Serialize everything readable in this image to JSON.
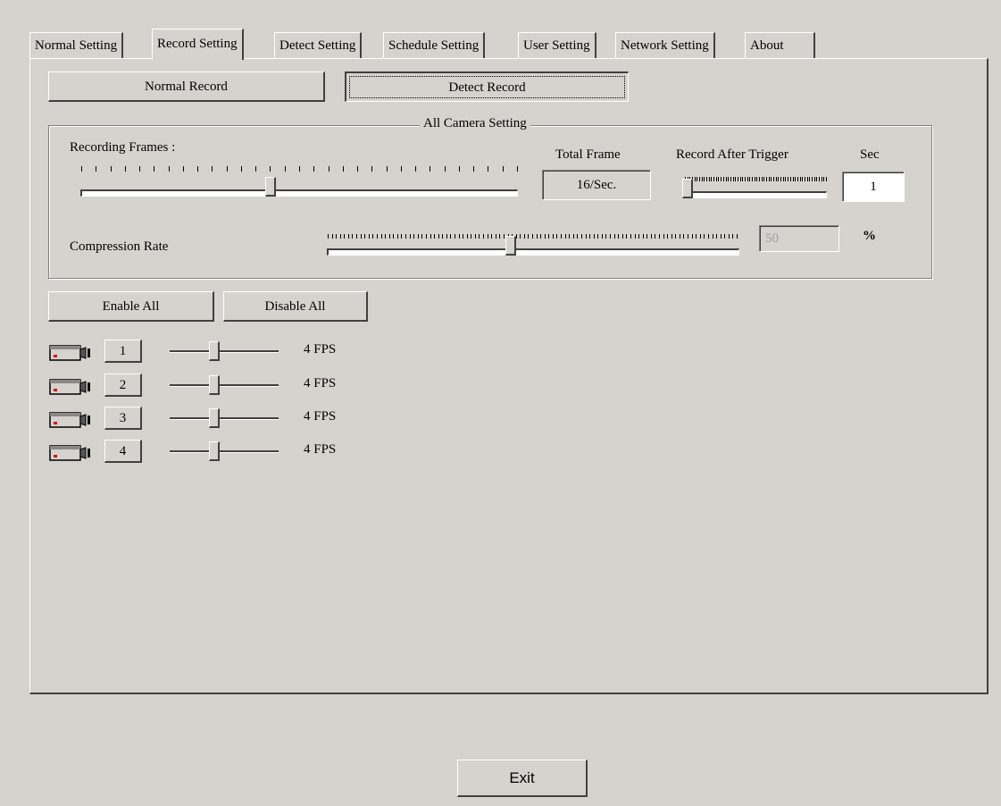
{
  "tabs": [
    {
      "label": "Normal Setting",
      "active": false
    },
    {
      "label": "Record Setting",
      "active": true
    },
    {
      "label": "Detect Setting",
      "active": false
    },
    {
      "label": "Schedule Setting",
      "active": false
    },
    {
      "label": "User Setting",
      "active": false
    },
    {
      "label": "Network Setting",
      "active": false
    },
    {
      "label": "About",
      "active": false
    }
  ],
  "mode_buttons": {
    "normal_record": "Normal Record",
    "detect_record": "Detect Record",
    "selected": "detect_record"
  },
  "all_camera": {
    "title": "All Camera Setting",
    "recording_frames_label": "Recording Frames :",
    "total_frame_label": "Total Frame",
    "total_frame_value": "16/Sec.",
    "record_after_trigger_label": "Record After Trigger",
    "sec_label": "Sec",
    "sec_value": "1",
    "compression_label": "Compression Rate",
    "compression_value": "50",
    "percent_symbol": "%"
  },
  "bulk_buttons": {
    "enable_all": "Enable All",
    "disable_all": "Disable All"
  },
  "cameras": [
    {
      "id": "1",
      "fps": "4 FPS"
    },
    {
      "id": "2",
      "fps": "4 FPS"
    },
    {
      "id": "3",
      "fps": "4 FPS"
    },
    {
      "id": "4",
      "fps": "4 FPS"
    }
  ],
  "exit_label": "Exit",
  "colors": {
    "face": "#d6d3ce",
    "shadow": "#404040",
    "highlight": "#ffffff",
    "disabled": "#a0a0a0"
  }
}
